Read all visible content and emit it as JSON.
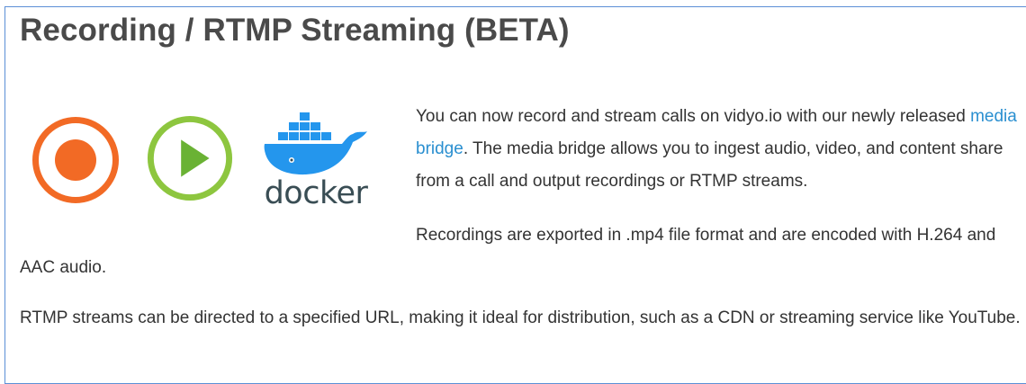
{
  "section": {
    "title": "Recording / RTMP Streaming (BETA)"
  },
  "icons": {
    "record": "record-icon",
    "play": "play-icon",
    "docker": "docker-logo",
    "docker_wordmark": "docker"
  },
  "intro": {
    "text_before_link": "You can now record and stream calls on vidyo.io with our newly released ",
    "link_label": "media bridge",
    "text_after_link": ". The media bridge allows you to ingest audio, video, and content share from a call and output recordings or RTMP streams."
  },
  "recordings": {
    "text": "Recordings are exported in .mp4 file format and are encoded with H.264 and AAC audio."
  },
  "rtmp": {
    "text": "RTMP streams can be directed to a specified URL, making it ideal for distribution, such as a CDN or streaming service like YouTube."
  },
  "colors": {
    "record": "#f26a25",
    "play_ring": "#8dc63f",
    "play_triangle": "#6ab234",
    "docker": "#2496ed",
    "docker_text": "#394d54",
    "link": "#2a8fd0",
    "frame_border": "#5b8fd6"
  }
}
